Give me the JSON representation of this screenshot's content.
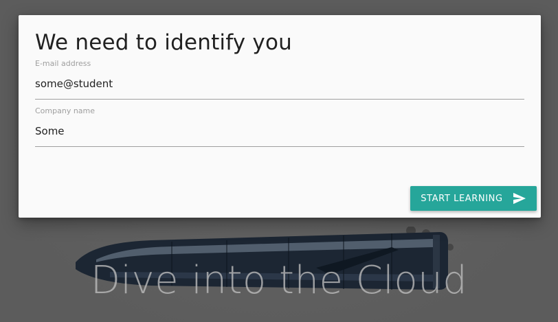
{
  "dialog": {
    "title": "We need to identify you",
    "email_field": {
      "label": "E-mail address",
      "value": "some@student"
    },
    "company_field": {
      "label": "Company name",
      "value": "Some"
    },
    "submit_button": {
      "label": "START LEARNING",
      "icon": "send-icon",
      "color": "#26a69a"
    }
  },
  "background": {
    "hero_title": "Dive into the Cloud",
    "image": "rocket-illustration"
  }
}
